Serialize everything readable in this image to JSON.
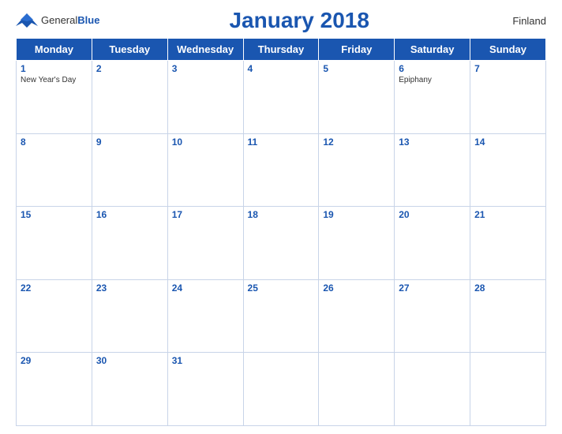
{
  "header": {
    "logo_general": "General",
    "logo_blue": "Blue",
    "title": "January 2018",
    "country": "Finland"
  },
  "days_of_week": [
    "Monday",
    "Tuesday",
    "Wednesday",
    "Thursday",
    "Friday",
    "Saturday",
    "Sunday"
  ],
  "weeks": [
    [
      {
        "day": 1,
        "holiday": "New Year's Day"
      },
      {
        "day": 2,
        "holiday": ""
      },
      {
        "day": 3,
        "holiday": ""
      },
      {
        "day": 4,
        "holiday": ""
      },
      {
        "day": 5,
        "holiday": ""
      },
      {
        "day": 6,
        "holiday": "Epiphany"
      },
      {
        "day": 7,
        "holiday": ""
      }
    ],
    [
      {
        "day": 8,
        "holiday": ""
      },
      {
        "day": 9,
        "holiday": ""
      },
      {
        "day": 10,
        "holiday": ""
      },
      {
        "day": 11,
        "holiday": ""
      },
      {
        "day": 12,
        "holiday": ""
      },
      {
        "day": 13,
        "holiday": ""
      },
      {
        "day": 14,
        "holiday": ""
      }
    ],
    [
      {
        "day": 15,
        "holiday": ""
      },
      {
        "day": 16,
        "holiday": ""
      },
      {
        "day": 17,
        "holiday": ""
      },
      {
        "day": 18,
        "holiday": ""
      },
      {
        "day": 19,
        "holiday": ""
      },
      {
        "day": 20,
        "holiday": ""
      },
      {
        "day": 21,
        "holiday": ""
      }
    ],
    [
      {
        "day": 22,
        "holiday": ""
      },
      {
        "day": 23,
        "holiday": ""
      },
      {
        "day": 24,
        "holiday": ""
      },
      {
        "day": 25,
        "holiday": ""
      },
      {
        "day": 26,
        "holiday": ""
      },
      {
        "day": 27,
        "holiday": ""
      },
      {
        "day": 28,
        "holiday": ""
      }
    ],
    [
      {
        "day": 29,
        "holiday": ""
      },
      {
        "day": 30,
        "holiday": ""
      },
      {
        "day": 31,
        "holiday": ""
      },
      {
        "day": null,
        "holiday": ""
      },
      {
        "day": null,
        "holiday": ""
      },
      {
        "day": null,
        "holiday": ""
      },
      {
        "day": null,
        "holiday": ""
      }
    ]
  ]
}
